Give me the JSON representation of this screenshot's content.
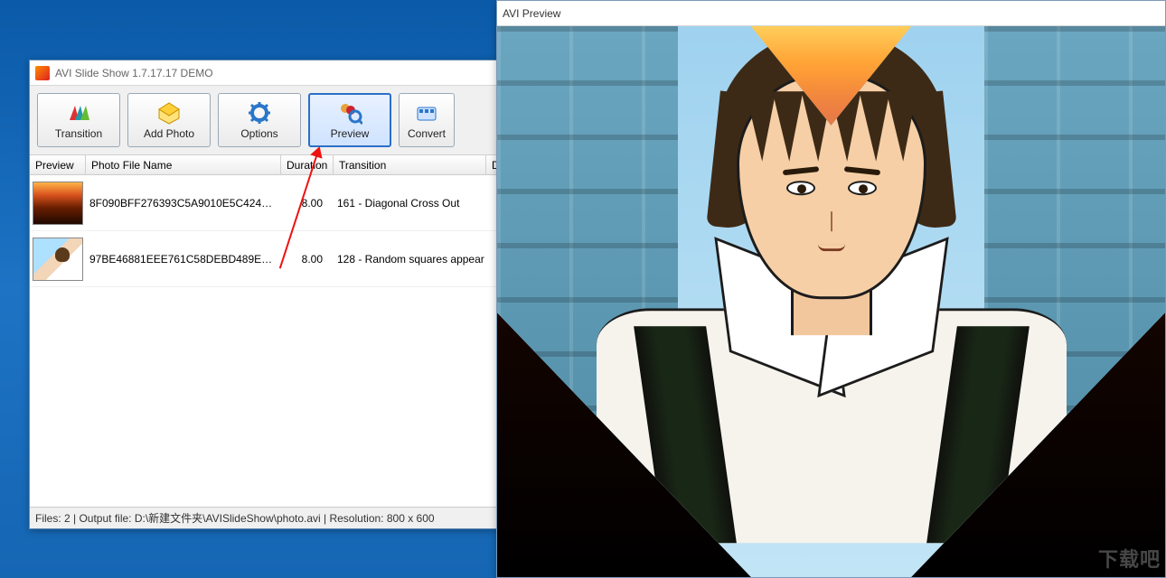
{
  "main_window": {
    "title": "AVI Slide Show 1.7.17.17 DEMO"
  },
  "toolbar": {
    "buttons": [
      {
        "label": "Transition",
        "icon": "transition-icon"
      },
      {
        "label": "Add Photo",
        "icon": "add-photo-icon"
      },
      {
        "label": "Options",
        "icon": "options-icon"
      },
      {
        "label": "Preview",
        "icon": "preview-icon",
        "active": true
      },
      {
        "label": "Convert",
        "icon": "convert-icon"
      }
    ]
  },
  "columns": {
    "preview": "Preview",
    "name": "Photo File Name",
    "duration": "Duration",
    "transition": "Transition",
    "d": "D"
  },
  "rows": [
    {
      "thumb": "sunset",
      "filename": "8F090BFF276393C5A9010E5C4242F0...",
      "duration": "8.00",
      "transition": "161 - Diagonal Cross Out"
    },
    {
      "thumb": "anime",
      "filename": "97BE46881EEE761C58DEBD489EE54...",
      "duration": "8.00",
      "transition": "128 - Random squares appear"
    }
  ],
  "status": {
    "text": "Files: 2 | Output file: D:\\新建文件夹\\AVISlideShow\\photo.avi | Resolution: 800 x 600",
    "files": 2,
    "output_file": "D:\\新建文件夹\\AVISlideShow\\photo.avi",
    "resolution": "800 x 600"
  },
  "preview_window": {
    "title": "AVI Preview"
  },
  "watermark": "下载吧"
}
